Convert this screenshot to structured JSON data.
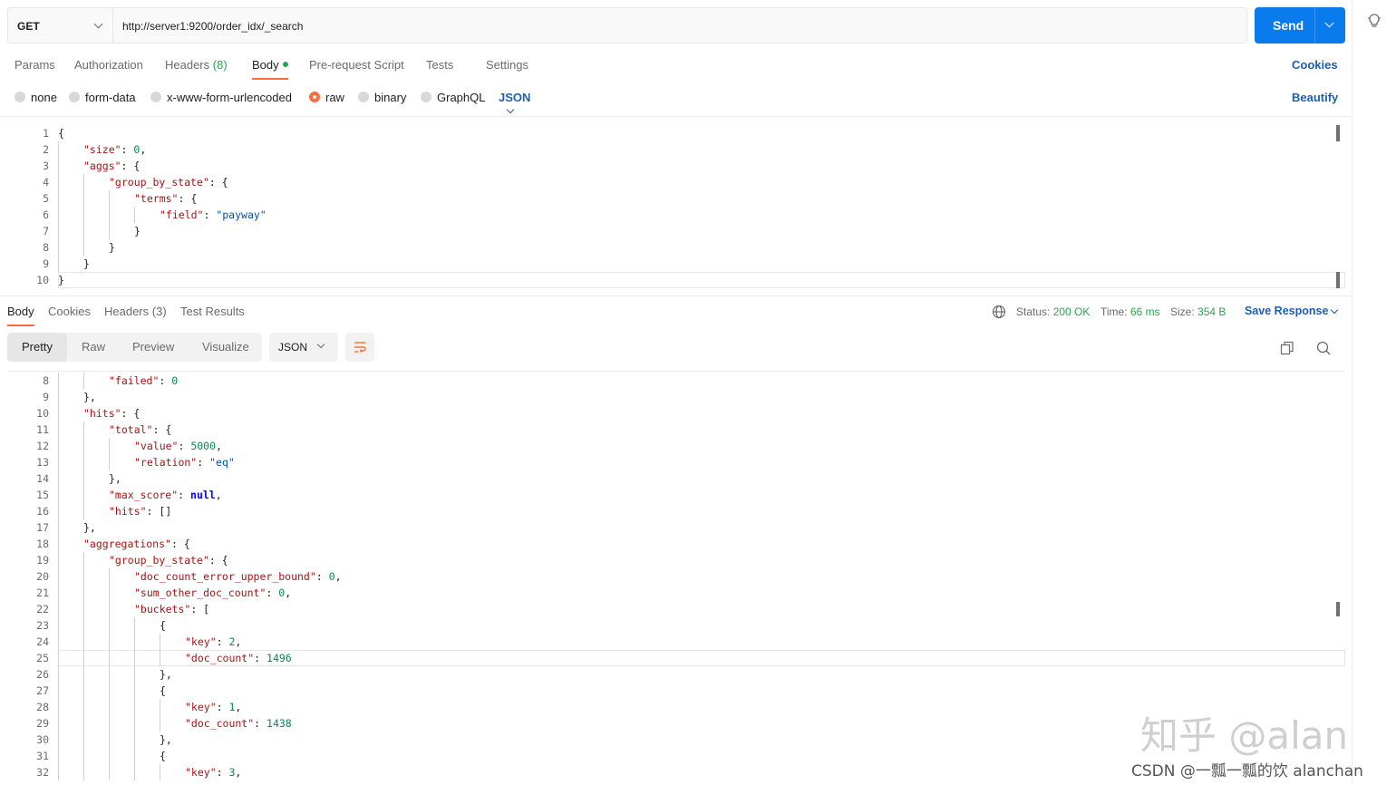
{
  "request": {
    "method": "GET",
    "url": "http://server1:9200/order_idx/_search",
    "send_label": "Send"
  },
  "request_tabs": {
    "params": "Params",
    "authorization": "Authorization",
    "headers": "Headers",
    "headers_count": "(8)",
    "body": "Body",
    "prerequest": "Pre-request Script",
    "tests": "Tests",
    "settings": "Settings",
    "cookies": "Cookies"
  },
  "body_types": {
    "none": "none",
    "form_data": "form-data",
    "urlencoded": "x-www-form-urlencoded",
    "raw": "raw",
    "binary": "binary",
    "graphql": "GraphQL",
    "language": "JSON",
    "beautify": "Beautify"
  },
  "request_editor": {
    "line_numbers": [
      "1",
      "2",
      "3",
      "4",
      "5",
      "6",
      "7",
      "8",
      "9",
      "10"
    ],
    "lines": [
      {
        "indent": 0,
        "parts": [
          [
            "p",
            "{"
          ]
        ]
      },
      {
        "indent": 1,
        "parts": [
          [
            "k",
            "\"size\""
          ],
          [
            "p",
            ": "
          ],
          [
            "n",
            "0"
          ],
          [
            "p",
            ","
          ]
        ]
      },
      {
        "indent": 1,
        "parts": [
          [
            "k",
            "\"aggs\""
          ],
          [
            "p",
            ": {"
          ]
        ]
      },
      {
        "indent": 2,
        "parts": [
          [
            "k",
            "\"group_by_state\""
          ],
          [
            "p",
            ": {"
          ]
        ]
      },
      {
        "indent": 3,
        "parts": [
          [
            "k",
            "\"terms\""
          ],
          [
            "p",
            ": {"
          ]
        ]
      },
      {
        "indent": 4,
        "parts": [
          [
            "k",
            "\"field\""
          ],
          [
            "p",
            ": "
          ],
          [
            "s",
            "\"payway\""
          ]
        ]
      },
      {
        "indent": 3,
        "parts": [
          [
            "p",
            "}"
          ]
        ]
      },
      {
        "indent": 2,
        "parts": [
          [
            "p",
            "}"
          ]
        ]
      },
      {
        "indent": 1,
        "parts": [
          [
            "p",
            "}"
          ]
        ]
      },
      {
        "indent": 0,
        "parts": [
          [
            "p",
            "}"
          ]
        ]
      }
    ]
  },
  "response_tabs": {
    "body": "Body",
    "cookies": "Cookies",
    "headers": "Headers",
    "headers_count": "(3)",
    "test_results": "Test Results"
  },
  "response_status": {
    "status_label": "Status:",
    "status_value": "200 OK",
    "time_label": "Time:",
    "time_value": "66 ms",
    "size_label": "Size:",
    "size_value": "354 B",
    "save_response": "Save Response"
  },
  "view_tabs": {
    "pretty": "Pretty",
    "raw": "Raw",
    "preview": "Preview",
    "visualize": "Visualize",
    "format": "JSON"
  },
  "response_editor": {
    "line_numbers": [
      "8",
      "9",
      "10",
      "11",
      "12",
      "13",
      "14",
      "15",
      "16",
      "17",
      "18",
      "19",
      "20",
      "21",
      "22",
      "23",
      "24",
      "25",
      "26",
      "27",
      "28",
      "29",
      "30",
      "31",
      "32"
    ],
    "lines": [
      {
        "indent": 2,
        "parts": [
          [
            "k",
            "\"failed\""
          ],
          [
            "p",
            ": "
          ],
          [
            "n",
            "0"
          ]
        ]
      },
      {
        "indent": 1,
        "parts": [
          [
            "p",
            "},"
          ]
        ]
      },
      {
        "indent": 1,
        "parts": [
          [
            "k",
            "\"hits\""
          ],
          [
            "p",
            ": {"
          ]
        ]
      },
      {
        "indent": 2,
        "parts": [
          [
            "k",
            "\"total\""
          ],
          [
            "p",
            ": {"
          ]
        ]
      },
      {
        "indent": 3,
        "parts": [
          [
            "k",
            "\"value\""
          ],
          [
            "p",
            ": "
          ],
          [
            "n",
            "5000"
          ],
          [
            "p",
            ","
          ]
        ]
      },
      {
        "indent": 3,
        "parts": [
          [
            "k",
            "\"relation\""
          ],
          [
            "p",
            ": "
          ],
          [
            "s",
            "\"eq\""
          ]
        ]
      },
      {
        "indent": 2,
        "parts": [
          [
            "p",
            "},"
          ]
        ]
      },
      {
        "indent": 2,
        "parts": [
          [
            "k",
            "\"max_score\""
          ],
          [
            "p",
            ": "
          ],
          [
            "kw",
            "null"
          ],
          [
            "p",
            ","
          ]
        ]
      },
      {
        "indent": 2,
        "parts": [
          [
            "k",
            "\"hits\""
          ],
          [
            "p",
            ": []"
          ]
        ]
      },
      {
        "indent": 1,
        "parts": [
          [
            "p",
            "},"
          ]
        ]
      },
      {
        "indent": 1,
        "parts": [
          [
            "k",
            "\"aggregations\""
          ],
          [
            "p",
            ": {"
          ]
        ]
      },
      {
        "indent": 2,
        "parts": [
          [
            "k",
            "\"group_by_state\""
          ],
          [
            "p",
            ": {"
          ]
        ]
      },
      {
        "indent": 3,
        "parts": [
          [
            "k",
            "\"doc_count_error_upper_bound\""
          ],
          [
            "p",
            ": "
          ],
          [
            "n",
            "0"
          ],
          [
            "p",
            ","
          ]
        ]
      },
      {
        "indent": 3,
        "parts": [
          [
            "k",
            "\"sum_other_doc_count\""
          ],
          [
            "p",
            ": "
          ],
          [
            "n",
            "0"
          ],
          [
            "p",
            ","
          ]
        ]
      },
      {
        "indent": 3,
        "parts": [
          [
            "k",
            "\"buckets\""
          ],
          [
            "p",
            ": ["
          ]
        ]
      },
      {
        "indent": 4,
        "parts": [
          [
            "p",
            "{"
          ]
        ]
      },
      {
        "indent": 5,
        "parts": [
          [
            "k",
            "\"key\""
          ],
          [
            "p",
            ": "
          ],
          [
            "n",
            "2"
          ],
          [
            "p",
            ","
          ]
        ]
      },
      {
        "indent": 5,
        "parts": [
          [
            "k",
            "\"doc_count\""
          ],
          [
            "p",
            ": "
          ],
          [
            "n",
            "1496"
          ]
        ]
      },
      {
        "indent": 4,
        "parts": [
          [
            "p",
            "},"
          ]
        ]
      },
      {
        "indent": 4,
        "parts": [
          [
            "p",
            "{"
          ]
        ]
      },
      {
        "indent": 5,
        "parts": [
          [
            "k",
            "\"key\""
          ],
          [
            "p",
            ": "
          ],
          [
            "n",
            "1"
          ],
          [
            "p",
            ","
          ]
        ]
      },
      {
        "indent": 5,
        "parts": [
          [
            "k",
            "\"doc_count\""
          ],
          [
            "p",
            ": "
          ],
          [
            "n",
            "1438"
          ]
        ]
      },
      {
        "indent": 4,
        "parts": [
          [
            "p",
            "},"
          ]
        ]
      },
      {
        "indent": 4,
        "parts": [
          [
            "p",
            "{"
          ]
        ]
      },
      {
        "indent": 5,
        "parts": [
          [
            "k",
            "\"key\""
          ],
          [
            "p",
            ": "
          ],
          [
            "n",
            "3"
          ],
          [
            "p",
            ","
          ]
        ]
      }
    ]
  },
  "watermark": {
    "zhihu": "知乎 @alan",
    "csdn": "CSDN @一瓢一瓢的饮 alanchan"
  },
  "colors": {
    "accent_orange": "#ff6c37",
    "send_blue": "#097bed",
    "link_blue": "#1d5fb0",
    "status_green": "#30a14e"
  },
  "icons": [
    "chevron-down-icon",
    "lightbulb-icon",
    "globe-icon",
    "wrap-lines-icon",
    "copy-icon",
    "search-icon"
  ]
}
